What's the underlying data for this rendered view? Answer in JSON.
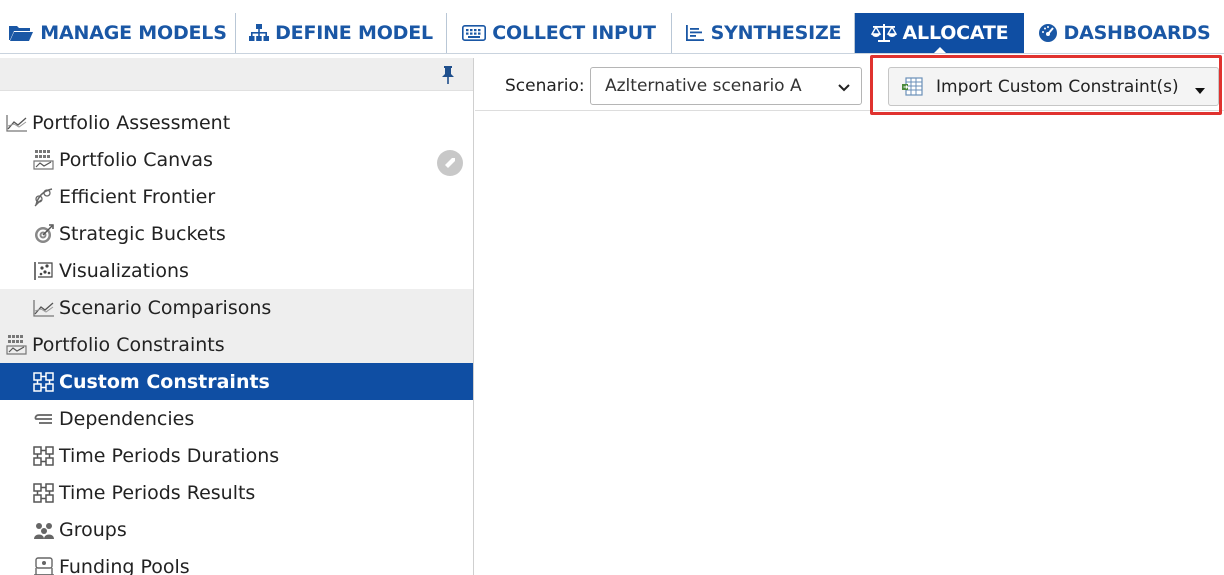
{
  "top_nav": {
    "tabs": [
      {
        "label": "MANAGE MODELS",
        "icon": "folder-open-icon"
      },
      {
        "label": "DEFINE MODEL",
        "icon": "sitemap-icon"
      },
      {
        "label": "COLLECT INPUT",
        "icon": "keyboard-icon"
      },
      {
        "label": "SYNTHESIZE",
        "icon": "bar-chart-icon"
      },
      {
        "label": "ALLOCATE",
        "icon": "balance-scale-icon",
        "active": true
      },
      {
        "label": "DASHBOARDS",
        "icon": "gauge-icon"
      }
    ],
    "active_color": "#0f4ea3",
    "text_color": "#1a57a5"
  },
  "sidebar": {
    "items": [
      {
        "label": "Portfolio Assessment",
        "level": 1,
        "icon": "line-chart-icon"
      },
      {
        "label": "Portfolio Canvas",
        "level": 2,
        "icon": "canvas-grid-icon"
      },
      {
        "label": "Efficient Frontier",
        "level": 2,
        "icon": "frontier-icon"
      },
      {
        "label": "Strategic Buckets",
        "level": 2,
        "icon": "target-icon"
      },
      {
        "label": "Visualizations",
        "level": 2,
        "icon": "visualization-icon"
      },
      {
        "label": "Scenario Comparisons",
        "level": 2,
        "icon": "line-chart-icon",
        "shaded": true
      },
      {
        "label": "Portfolio Constraints",
        "level": 1,
        "icon": "canvas-grid-icon",
        "shaded": true
      },
      {
        "label": "Custom Constraints",
        "level": 2,
        "icon": "constraints-icon",
        "selected": true
      },
      {
        "label": "Dependencies",
        "level": 2,
        "icon": "dependencies-icon"
      },
      {
        "label": "Time Periods Durations",
        "level": 2,
        "icon": "constraints-icon"
      },
      {
        "label": "Time Periods Results",
        "level": 2,
        "icon": "constraints-icon"
      },
      {
        "label": "Groups",
        "level": 2,
        "icon": "groups-icon"
      },
      {
        "label": "Funding Pools",
        "level": 2,
        "icon": "funding-pools-icon"
      }
    ],
    "selected_color": "#0f4ea3"
  },
  "toolbar": {
    "scenario_label": "Scenario:",
    "scenario_value": "Azlternative scenario A",
    "import_label": "Import Custom Constraint(s)"
  },
  "highlight_color": "#e0322f"
}
